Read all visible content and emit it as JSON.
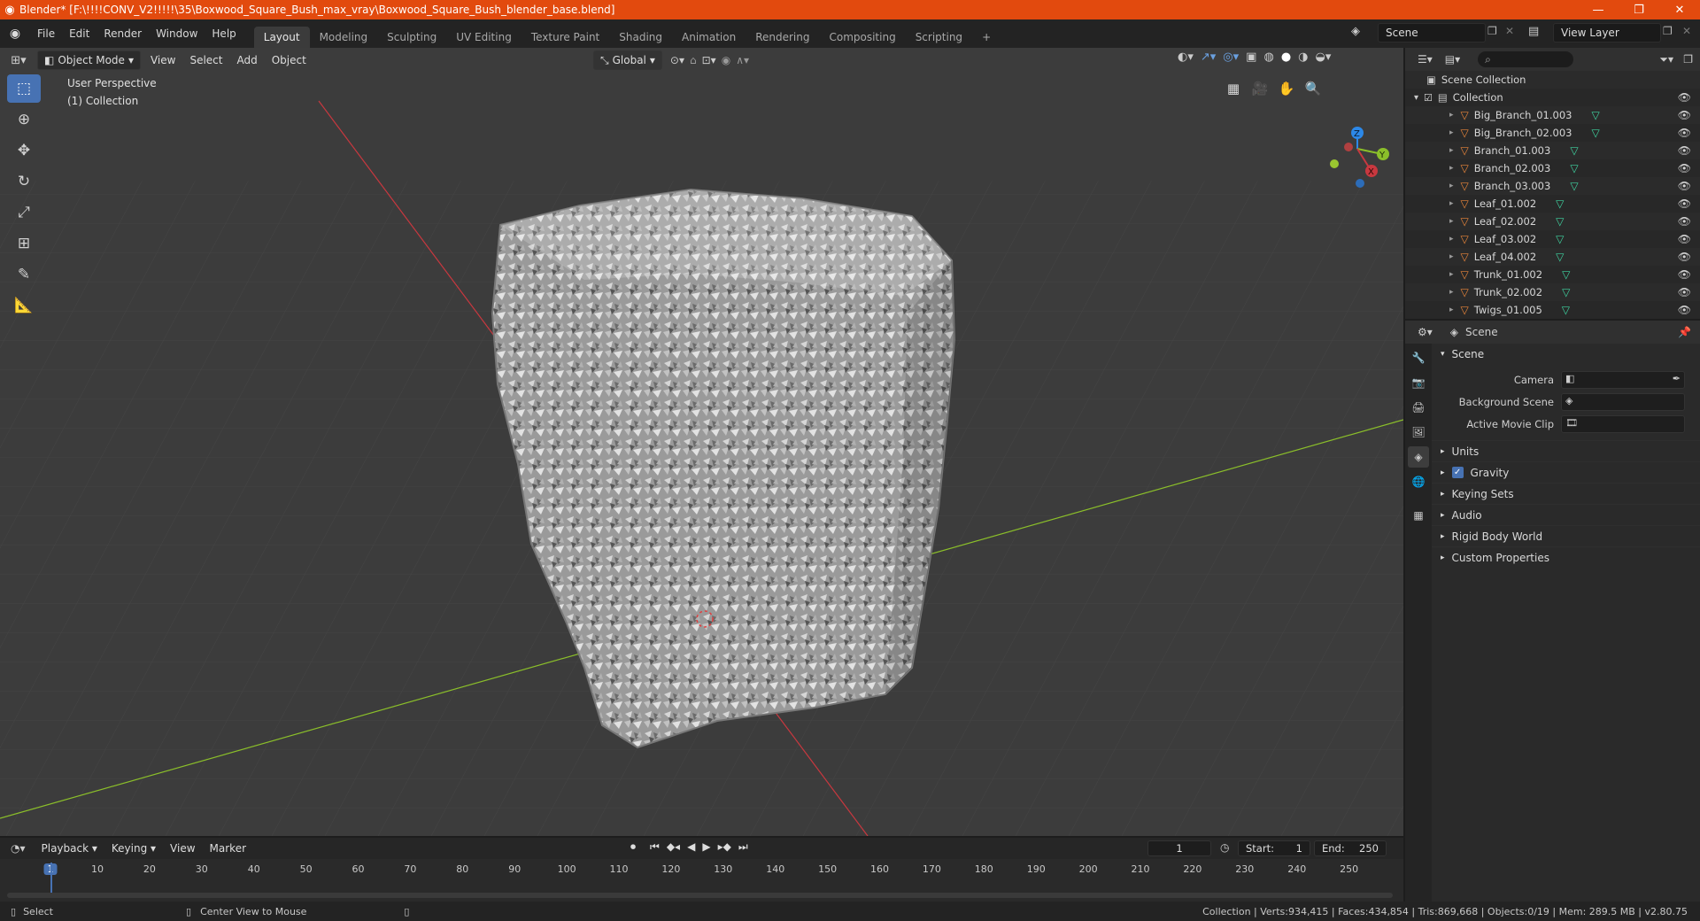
{
  "window": {
    "title": "Blender* [F:\\!!!!CONV_V2!!!!!\\35\\Boxwood_Square_Bush_max_vray\\Boxwood_Square_Bush_blender_base.blend]",
    "minimize": "—",
    "maximize": "❐",
    "close": "✕"
  },
  "menu": [
    "File",
    "Edit",
    "Render",
    "Window",
    "Help"
  ],
  "workspaces": [
    "Layout",
    "Modeling",
    "Sculpting",
    "UV Editing",
    "Texture Paint",
    "Shading",
    "Animation",
    "Rendering",
    "Compositing",
    "Scripting"
  ],
  "active_workspace": "Layout",
  "scene_name": "Scene",
  "view_layer": "View Layer",
  "viewport": {
    "mode": "Object Mode",
    "menus": [
      "View",
      "Select",
      "Add",
      "Object"
    ],
    "transform_orientation": "Global",
    "perspective_label": "User Perspective",
    "collection_label": "(1) Collection",
    "gizmo_axes": [
      "X",
      "Y",
      "Z"
    ]
  },
  "outliner": {
    "scene_collection": "Scene Collection",
    "collection": "Collection",
    "objects": [
      "Big_Branch_01.003",
      "Big_Branch_02.003",
      "Branch_01.003",
      "Branch_02.003",
      "Branch_03.003",
      "Leaf_01.002",
      "Leaf_02.002",
      "Leaf_03.002",
      "Leaf_04.002",
      "Trunk_01.002",
      "Trunk_02.002",
      "Twigs_01.005"
    ]
  },
  "properties": {
    "header_title": "Scene",
    "panel_title": "Scene",
    "camera_label": "Camera",
    "background_scene_label": "Background Scene",
    "active_movie_clip_label": "Active Movie Clip",
    "sub_panels": [
      "Units",
      "Gravity",
      "Keying Sets",
      "Audio",
      "Rigid Body World",
      "Custom Properties"
    ],
    "gravity_checked": true
  },
  "timeline": {
    "menus": [
      "Playback",
      "Keying",
      "View",
      "Marker"
    ],
    "current_frame": "1",
    "start_label": "Start:",
    "start": "1",
    "end_label": "End:",
    "end": "250",
    "ticks": [
      "1",
      "10",
      "20",
      "30",
      "40",
      "50",
      "60",
      "70",
      "80",
      "90",
      "100",
      "110",
      "120",
      "130",
      "140",
      "150",
      "160",
      "170",
      "180",
      "190",
      "200",
      "210",
      "220",
      "230",
      "240",
      "250"
    ]
  },
  "statusbar": {
    "select": "Select",
    "center_view": "Center View to Mouse",
    "stats": "Collection | Verts:934,415 | Faces:434,854 | Tris:869,668 | Objects:0/19 | Mem: 289.5 MB | v2.80.75"
  },
  "colors": {
    "titlebar": "#e24a0e",
    "accent": "#4772b3",
    "x_axis": "#c8383f",
    "y_axis": "#8bbf2a",
    "z_axis": "#2c88e8",
    "object_icon": "#e8853a",
    "mesh_icon": "#3fd3a0"
  }
}
